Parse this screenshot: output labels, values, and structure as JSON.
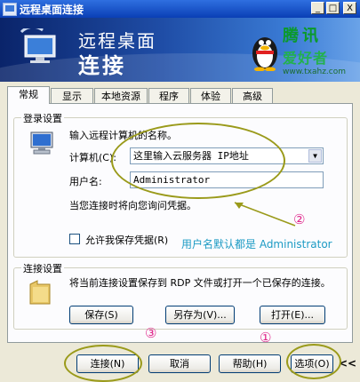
{
  "window": {
    "title": "远程桌面连接",
    "controls": {
      "minimize": "_",
      "maximize": "□",
      "close": "X"
    }
  },
  "banner": {
    "line1": "远程桌面",
    "line2": "连接",
    "watermark": {
      "line1": "腾讯",
      "line2": "爱好者",
      "url": "www.txahz.com"
    }
  },
  "tabs": [
    {
      "label": "常规",
      "active": true
    },
    {
      "label": "显示"
    },
    {
      "label": "本地资源"
    },
    {
      "label": "程序"
    },
    {
      "label": "体验"
    },
    {
      "label": "高级"
    }
  ],
  "login": {
    "group_label": "登录设置",
    "instruction": "输入远程计算机的名称。",
    "computer_label": "计算机(C):",
    "computer_value": "这里输入云服务器 IP地址",
    "username_label": "用户名:",
    "username_value": "Administrator",
    "credential_note": "当您连接时将向您询问凭据。",
    "save_credentials_label": "允许我保存凭据(R)",
    "save_credentials_checked": false
  },
  "connection": {
    "group_label": "连接设置",
    "description": "将当前连接设置保存到 RDP 文件或打开一个已保存的连接。",
    "save_button": "保存(S)",
    "save_as_button": "另存为(V)...",
    "open_button": "打开(E)..."
  },
  "footer": {
    "connect_button": "连接(N)",
    "cancel_button": "取消",
    "help_button": "帮助(H)",
    "options_button": "选项(O)",
    "collapse_glyph": "<<"
  },
  "annotations": {
    "marker_1": "①",
    "marker_2": "②",
    "marker_3": "③",
    "note_username": "用户名默认都是 Administrator"
  },
  "colors": {
    "title_bar": "#0a3fb5",
    "banner": "#1f4da6",
    "annotation_oval": "#9a9a1a",
    "annotation_marker": "#e0288c",
    "annotation_note": "#1d9bc4"
  }
}
